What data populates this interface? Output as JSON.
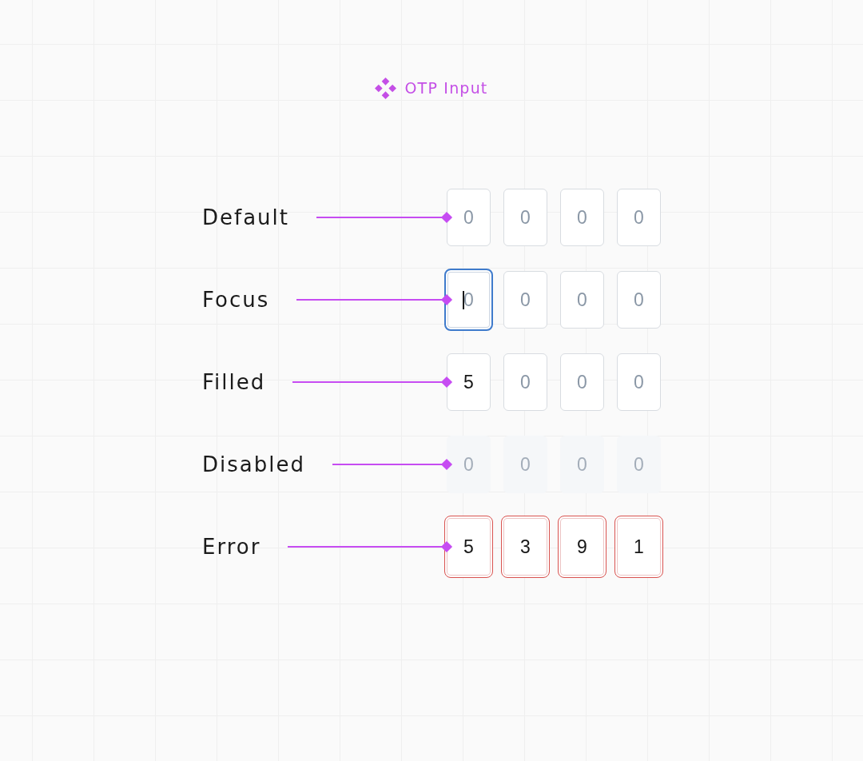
{
  "title": {
    "text": "OTP Input"
  },
  "rows": [
    {
      "label": "Default",
      "kind": "default",
      "cells": [
        {
          "placeholder": "0"
        },
        {
          "placeholder": "0"
        },
        {
          "placeholder": "0"
        },
        {
          "placeholder": "0"
        }
      ]
    },
    {
      "label": "Focus",
      "kind": "focus",
      "cells": [
        {
          "placeholder": "0",
          "focused": true
        },
        {
          "placeholder": "0",
          "focused": false
        },
        {
          "placeholder": "0",
          "focused": false
        },
        {
          "placeholder": "0",
          "focused": false
        }
      ]
    },
    {
      "label": "Filled",
      "kind": "filled",
      "cells": [
        {
          "value": "5"
        },
        {
          "placeholder": "0"
        },
        {
          "placeholder": "0"
        },
        {
          "placeholder": "0"
        }
      ]
    },
    {
      "label": "Disabled",
      "kind": "disabled",
      "cells": [
        {
          "placeholder": "0"
        },
        {
          "placeholder": "0"
        },
        {
          "placeholder": "0"
        },
        {
          "placeholder": "0"
        }
      ]
    },
    {
      "label": "Error",
      "kind": "error",
      "cells": [
        {
          "value": "5"
        },
        {
          "value": "3"
        },
        {
          "value": "9"
        },
        {
          "value": "1"
        }
      ]
    }
  ]
}
